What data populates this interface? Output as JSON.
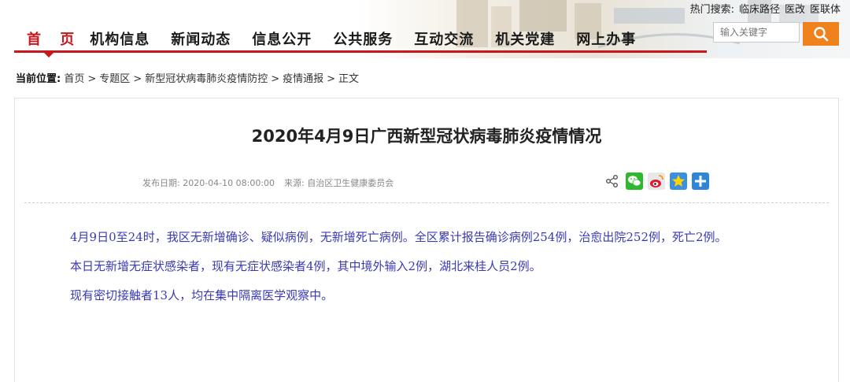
{
  "header": {
    "hot_search": {
      "label": "热门搜索:",
      "items": [
        "临床路径",
        "医改",
        "医联体"
      ]
    },
    "nav": [
      "首 页",
      "机构信息",
      "新闻动态",
      "信息公开",
      "公共服务",
      "互动交流",
      "机关党建",
      "网上办事"
    ],
    "search": {
      "placeholder": "输入关键字"
    }
  },
  "breadcrumb": {
    "label": "当前位置:",
    "items": [
      "首页",
      "专题区",
      "新型冠状病毒肺炎疫情防控",
      "疫情通报",
      "正文"
    ],
    "separator": ">"
  },
  "article": {
    "title": "2020年4月9日广西新型冠状病毒肺炎疫情情况",
    "publish_label": "发布日期:",
    "publish_date": "2020-04-10 08:00:00",
    "source_label": "来源:",
    "source": "自治区卫生健康委员会",
    "paragraphs": [
      "4月9日0至24时，我区无新增确诊、疑似病例，无新增死亡病例。全区累计报告确诊病例254例，治愈出院252例，死亡2例。",
      "本日无新增无症状感染者，现有无症状感染者4例，其中境外输入2例，湖北来桂人员2例。",
      "现有密切接触者13人，均在集中隔离医学观察中。"
    ]
  },
  "share_icons": [
    "share-icon",
    "wechat-icon",
    "weibo-icon",
    "qzone-icon",
    "more-share-icon"
  ],
  "colors": {
    "accent_red": "#c8161d",
    "search_orange": "#f0821e",
    "content_blue": "#3a3ab5"
  }
}
